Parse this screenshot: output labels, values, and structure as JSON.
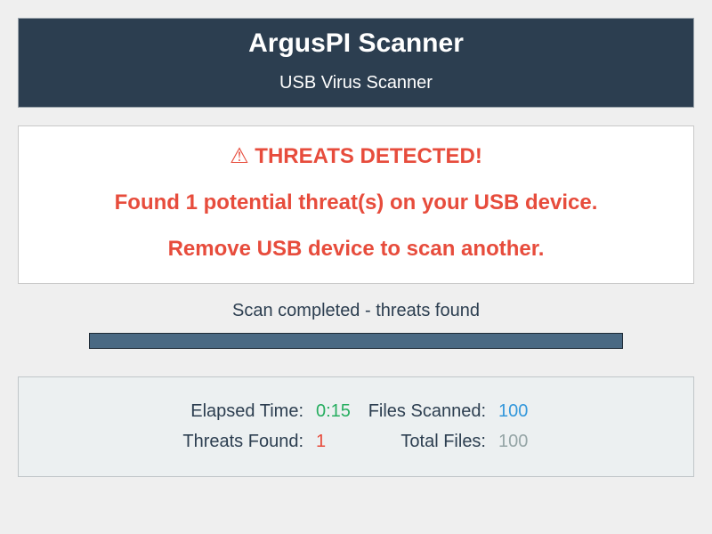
{
  "header": {
    "title": "ArgusPI Scanner",
    "subtitle": "USB Virus Scanner"
  },
  "alert": {
    "warning_icon": "warning-icon",
    "heading": "⚠ THREATS DETECTED!",
    "message": "Found 1 potential threat(s) on your USB device.",
    "instruction": "Remove USB device to scan another."
  },
  "status": {
    "text": "Scan completed - threats found",
    "progress_percent": 100
  },
  "stats": {
    "elapsed_label": "Elapsed Time:",
    "elapsed_value": "0:15",
    "files_scanned_label": "Files Scanned:",
    "files_scanned_value": "100",
    "threats_label": "Threats Found:",
    "threats_value": "1",
    "total_files_label": "Total Files:",
    "total_files_value": "100"
  },
  "colors": {
    "header_bg": "#2c3e50",
    "alert_red": "#e74c3c",
    "success_green": "#27ae60",
    "info_blue": "#3498db",
    "muted_gray": "#95a5a6",
    "progress_fill": "#4a6983"
  }
}
